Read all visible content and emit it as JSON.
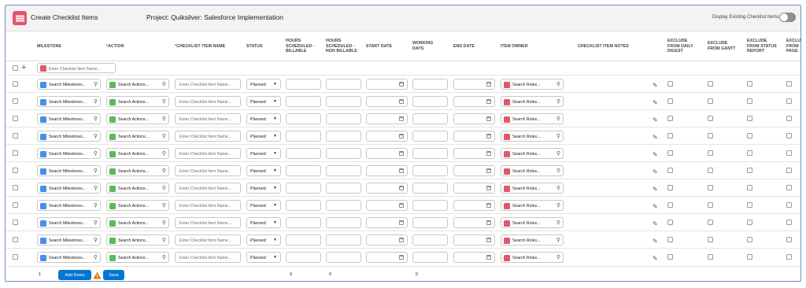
{
  "header": {
    "title": "Create Checklist Items",
    "project": "Project: Quiksilver: Salesforce Implementation",
    "display_existing_label": "Display Existing Checklist Items",
    "display_existing_on": false
  },
  "columns": {
    "milestone": "MILESTONE",
    "action": "ACTION",
    "checklist_item_name": "CHECKLIST ITEM NAME",
    "status": "STATUS",
    "hours_billable_1": "HOURS",
    "hours_billable_2": "SCHEDULED -",
    "hours_billable_3": "BILLABLE",
    "hours_non_billable_1": "HOURS",
    "hours_non_billable_2": "SCHEDULED -",
    "hours_non_billable_3": "NON BILLABLE",
    "start_date": "START DATE",
    "working_days_1": "WORKING",
    "working_days_2": "DAYS",
    "end_date": "END DATE",
    "item_owner": "ITEM OWNER",
    "checklist_item_notes": "CHECKLIST ITEM NOTES",
    "exclude_daily_1": "EXCLUDE",
    "exclude_daily_2": "FROM DAILY",
    "exclude_daily_3": "DIGEST",
    "exclude_gantt_1": "EXCLUDE",
    "exclude_gantt_2": "FROM GANTT",
    "exclude_status_1": "EXCLUDE",
    "exclude_status_2": "FROM STATUS",
    "exclude_status_3": "REPORT",
    "exclude_page_1": "EXCLU",
    "exclude_page_2": "FROM",
    "exclude_page_3": "PAGE",
    "required_marker": "*"
  },
  "new_item": {
    "placeholder": "Enter Checklist Item Name..."
  },
  "row_fields": {
    "milestone_placeholder": "Search Milestones...",
    "action_placeholder": "Search Actions...",
    "item_name_placeholder": "Enter Checklist Item Name...",
    "status_value": "Planned",
    "owner_placeholder": "Search Roles..."
  },
  "row_count": 11,
  "footer": {
    "rows_value": "1",
    "add_rows_label": "Add Rows",
    "save_label": "Save",
    "total_billable": "0",
    "total_non_billable": "0",
    "total_working_days": "0"
  },
  "colors": {
    "accent_blue": "#0176d3",
    "milestone_icon": "#4a8fe7",
    "action_icon": "#5cb85c",
    "owner_icon": "#e3566c",
    "warning": "#dd7a01"
  },
  "icons": [
    "checklist-app-icon",
    "search-icon",
    "calendar-icon",
    "pencil-icon",
    "warning-icon",
    "plus-icon"
  ]
}
